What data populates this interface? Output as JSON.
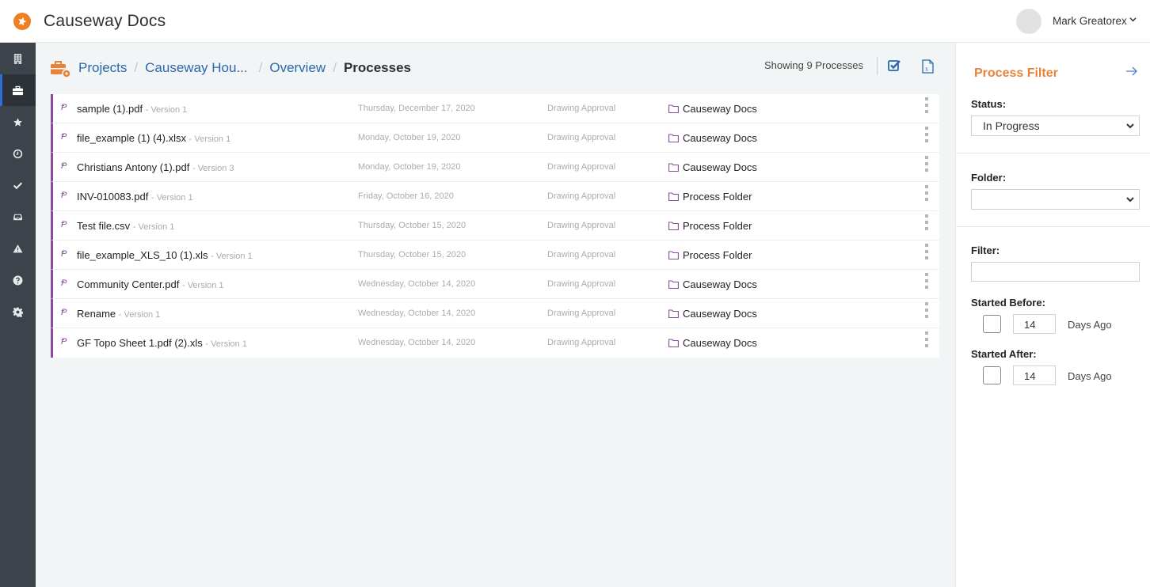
{
  "app": {
    "title": "Causeway Docs",
    "brand_color": "#f07f22"
  },
  "user": {
    "name": "Mark Greatorex",
    "caret": "⌄"
  },
  "leftnav": {
    "items": [
      {
        "icon": "building-icon",
        "active": false
      },
      {
        "icon": "briefcase-icon",
        "active": true
      },
      {
        "icon": "star-icon",
        "active": false
      },
      {
        "icon": "clock-icon",
        "active": false
      },
      {
        "icon": "checkmark-icon",
        "active": false
      },
      {
        "icon": "inbox-icon",
        "active": false
      },
      {
        "icon": "warning-icon",
        "active": false
      },
      {
        "icon": "help-icon",
        "active": false
      },
      {
        "icon": "gear-icon",
        "active": false
      }
    ]
  },
  "breadcrumb": {
    "items": [
      "Projects",
      "Causeway Hou...",
      "Overview"
    ],
    "current": "Processes",
    "separator": "/"
  },
  "toolbar": {
    "showing": "Showing 9 Processes"
  },
  "processes": [
    {
      "name": "sample (1).pdf",
      "version": "- Version 1",
      "date": "Thursday, December 17, 2020",
      "process": "Drawing Approval",
      "folder": "Causeway Docs"
    },
    {
      "name": "file_example (1) (4).xlsx",
      "version": "- Version 1",
      "date": "Monday, October 19, 2020",
      "process": "Drawing Approval",
      "folder": "Causeway Docs"
    },
    {
      "name": "Christians Antony (1).pdf",
      "version": "- Version 3",
      "date": "Monday, October 19, 2020",
      "process": "Drawing Approval",
      "folder": "Causeway Docs"
    },
    {
      "name": "INV-010083.pdf",
      "version": "- Version 1",
      "date": "Friday, October 16, 2020",
      "process": "Drawing Approval",
      "folder": "Process Folder"
    },
    {
      "name": "Test file.csv",
      "version": "- Version 1",
      "date": "Thursday, October 15, 2020",
      "process": "Drawing Approval",
      "folder": "Process Folder"
    },
    {
      "name": "file_example_XLS_10 (1).xls",
      "version": "- Version 1",
      "date": "Thursday, October 15, 2020",
      "process": "Drawing Approval",
      "folder": "Process Folder"
    },
    {
      "name": "Community Center.pdf",
      "version": "- Version 1",
      "date": "Wednesday, October 14, 2020",
      "process": "Drawing Approval",
      "folder": "Causeway Docs"
    },
    {
      "name": "Rename",
      "version": "- Version 1",
      "date": "Wednesday, October 14, 2020",
      "process": "Drawing Approval",
      "folder": "Causeway Docs"
    },
    {
      "name": "GF Topo Sheet 1.pdf (2).xls",
      "version": "- Version 1",
      "date": "Wednesday, October 14, 2020",
      "process": "Drawing Approval",
      "folder": "Causeway Docs"
    }
  ],
  "filter": {
    "title": "Process Filter",
    "status_label": "Status:",
    "status_value": "In Progress",
    "folder_label": "Folder:",
    "folder_value": "",
    "filter_label": "Filter:",
    "filter_value": "",
    "started_before_label": "Started Before:",
    "started_before_checked": false,
    "started_before_days": "14",
    "started_after_label": "Started After:",
    "started_after_checked": false,
    "started_after_days": "14",
    "days_ago": "Days Ago",
    "accent_color": "#e8833a"
  }
}
